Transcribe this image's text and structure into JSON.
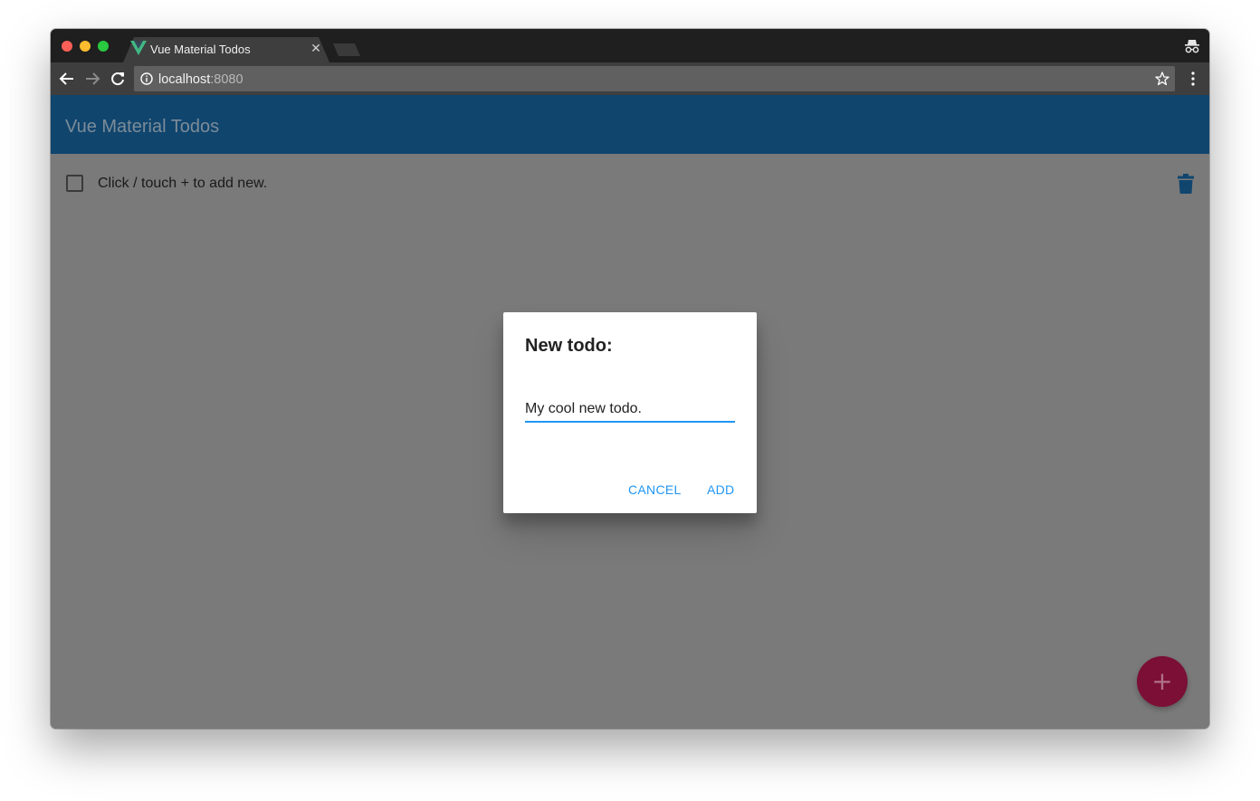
{
  "browser": {
    "tab_title": "Vue Material Todos",
    "url_host": "localhost",
    "url_port": ":8080",
    "icons": [
      "vue-logo",
      "close",
      "incognito",
      "back-arrow",
      "forward-arrow",
      "reload",
      "info",
      "star",
      "kebab-menu"
    ]
  },
  "app": {
    "title": "Vue Material Todos",
    "todos": [
      {
        "text": "Click / touch + to add new.",
        "done": false
      }
    ],
    "fab_glyph": "+"
  },
  "dialog": {
    "title": "New todo:",
    "input_value": "My cool new todo.",
    "cancel_label": "CANCEL",
    "add_label": "ADD"
  },
  "colors": {
    "app_bar": "#10456e",
    "accent": "#2196f3",
    "fab": "#7b0f35",
    "backdrop": "#7a7a7a"
  }
}
